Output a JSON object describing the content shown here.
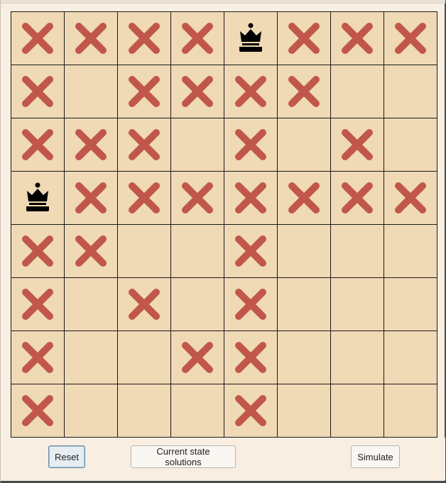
{
  "board": {
    "size": 8,
    "rows": [
      [
        "x",
        "x",
        "x",
        "x",
        "queen",
        "x",
        "x",
        "x"
      ],
      [
        "x",
        "",
        "x",
        "x",
        "x",
        "x",
        "",
        ""
      ],
      [
        "x",
        "x",
        "x",
        "",
        "x",
        "",
        "x",
        ""
      ],
      [
        "queen",
        "x",
        "x",
        "x",
        "x",
        "x",
        "x",
        "x"
      ],
      [
        "x",
        "x",
        "",
        "",
        "x",
        "",
        "",
        ""
      ],
      [
        "x",
        "",
        "x",
        "",
        "x",
        "",
        "",
        ""
      ],
      [
        "x",
        "",
        "",
        "x",
        "x",
        "",
        "",
        ""
      ],
      [
        "x",
        "",
        "",
        "",
        "x",
        "",
        "",
        ""
      ]
    ],
    "colors": {
      "square": "#f0d9b5",
      "grid_line": "#1a1a1a",
      "x_mark": "#c0574a",
      "queen": "#000000"
    },
    "icons": {
      "queen": "queen-icon",
      "x": "x-mark-icon"
    }
  },
  "controls": {
    "reset_label": "Reset",
    "solutions_label": "Current state solutions",
    "simulate_label": "Simulate"
  }
}
